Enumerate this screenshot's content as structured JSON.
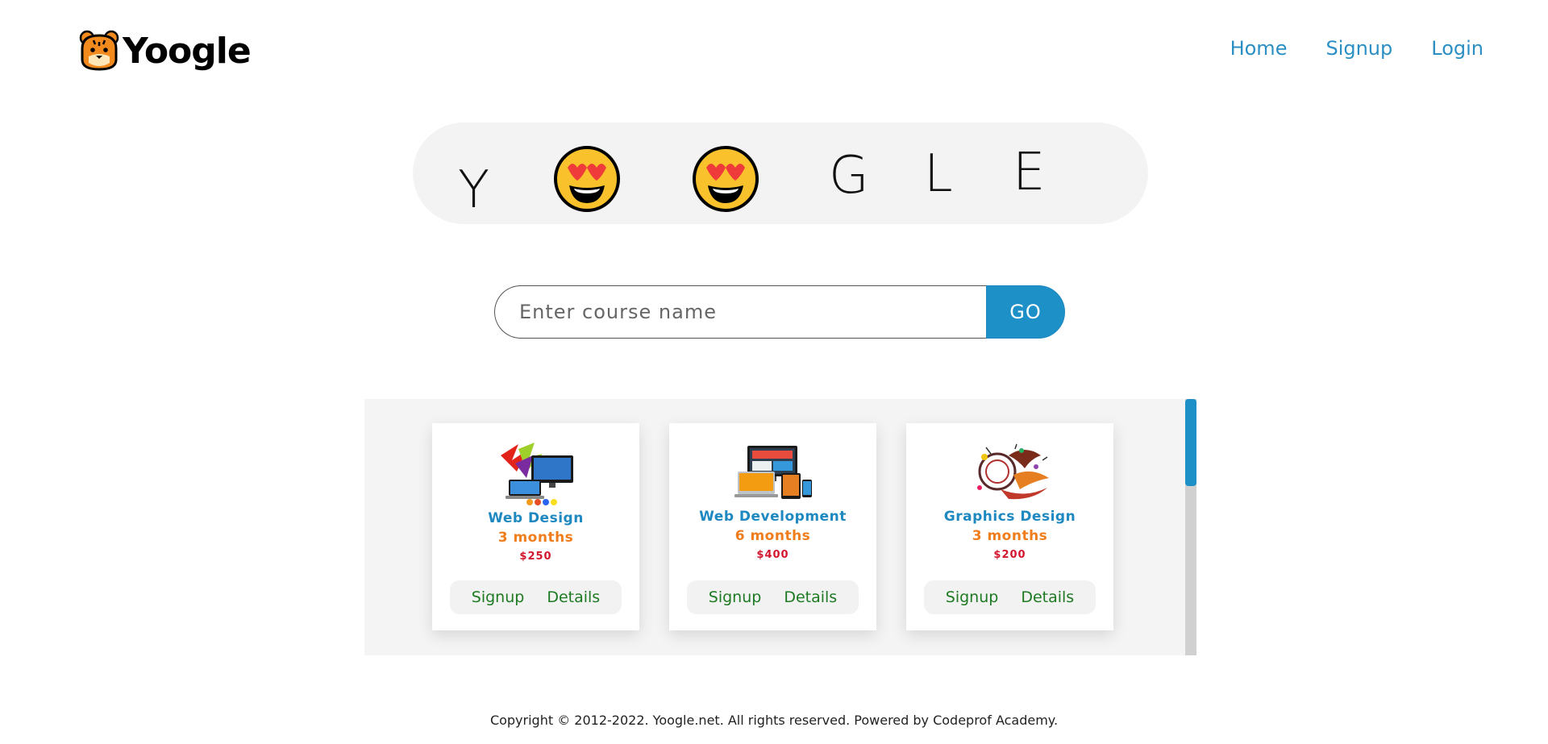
{
  "header": {
    "logo_text": "Yoogle",
    "nav": [
      {
        "label": "Home"
      },
      {
        "label": "Signup"
      },
      {
        "label": "Login"
      }
    ]
  },
  "banner": {
    "letters": [
      "Y",
      "G",
      "L",
      "E"
    ],
    "emoji_names": [
      "heart-eyes-emoji",
      "heart-eyes-emoji"
    ]
  },
  "search": {
    "placeholder": "Enter course name",
    "value": "",
    "button_label": "GO"
  },
  "courses": [
    {
      "title": "Web Design",
      "duration": "3 months",
      "price": "$250",
      "signup_label": "Signup",
      "details_label": "Details",
      "icon": "web-design-image"
    },
    {
      "title": "Web Development",
      "duration": "6 months",
      "price": "$400",
      "signup_label": "Signup",
      "details_label": "Details",
      "icon": "web-development-image"
    },
    {
      "title": "Graphics Design",
      "duration": "3 months",
      "price": "$200",
      "signup_label": "Signup",
      "details_label": "Details",
      "icon": "graphics-design-image"
    }
  ],
  "footer": {
    "text": "Copyright © 2012-2022. Yoogle.net. All rights reserved. Powered by Codeprof Academy."
  },
  "colors": {
    "accent": "#1e90c8",
    "nav_link": "#2b8fc4",
    "duration": "#f07d1c",
    "price": "#d2172e",
    "action_link": "#1d7a22"
  }
}
